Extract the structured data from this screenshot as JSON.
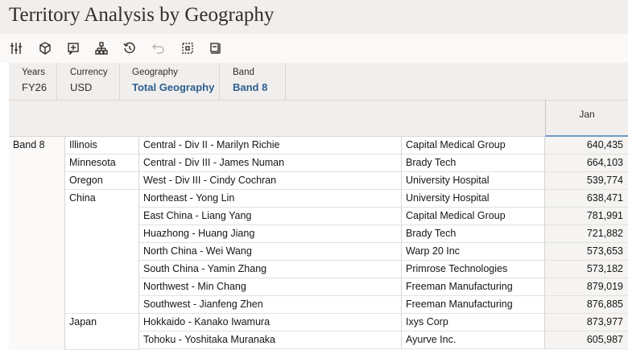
{
  "title": "Territory Analysis by Geography",
  "toolbar": {
    "icons": [
      "sliders-icon",
      "cube-icon",
      "add-comment-icon",
      "hierarchy-icon",
      "history-icon",
      "undo-icon",
      "grid-cell-icon",
      "panel-icon"
    ]
  },
  "pov": {
    "years": {
      "label": "Years",
      "value": "FY26"
    },
    "currency": {
      "label": "Currency",
      "value": "USD"
    },
    "geography": {
      "label": "Geography",
      "value": "Total Geography"
    },
    "band": {
      "label": "Band",
      "value": "Band 8"
    }
  },
  "grid": {
    "column_header": "Jan",
    "band_label": "Band 8",
    "geographies": [
      "Illinois",
      "Minnesota",
      "Oregon",
      "China",
      "Japan"
    ],
    "rows": [
      {
        "territory": "Central -  Div II - Marilyn Richie",
        "customer": "Capital Medical Group",
        "value": "640,435"
      },
      {
        "territory": "Central -  Div III - James Numan",
        "customer": "Brady Tech",
        "value": "664,103"
      },
      {
        "territory": "West -  Div III - Cindy Cochran",
        "customer": "University Hospital",
        "value": "539,774"
      },
      {
        "territory": "Northeast - Yong Lin",
        "customer": "University Hospital",
        "value": "638,471"
      },
      {
        "territory": "East China - Liang Yang",
        "customer": "Capital Medical Group",
        "value": "781,991"
      },
      {
        "territory": "Huazhong - Huang Jiang",
        "customer": "Brady Tech",
        "value": "721,882"
      },
      {
        "territory": "North China - Wei Wang",
        "customer": "Warp 20 Inc",
        "value": "573,653"
      },
      {
        "territory": "South China - Yamin Zhang",
        "customer": "Primrose Technologies",
        "value": "573,182"
      },
      {
        "territory": "Northwest - Min Chang",
        "customer": "Freeman Manufacturing",
        "value": "879,019"
      },
      {
        "territory": "Southwest - Jianfeng Zhen",
        "customer": "Freeman Manufacturing",
        "value": "876,885"
      },
      {
        "territory": "Hokkaido - Kanako Iwamura",
        "customer": "Ixys Corp",
        "value": "873,977"
      },
      {
        "territory": "Tohoku - Yoshitaka Muranaka",
        "customer": "Ayurve Inc.",
        "value": "605,987"
      }
    ]
  }
}
